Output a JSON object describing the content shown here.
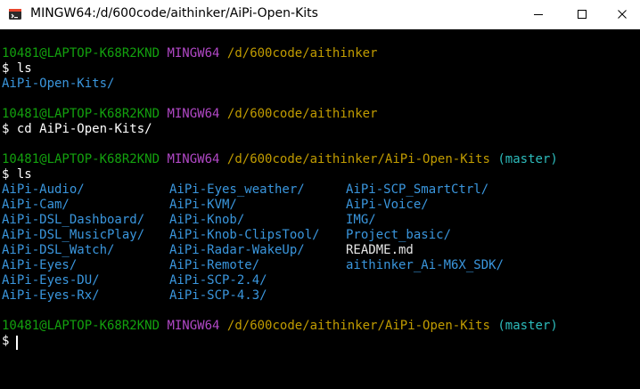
{
  "window": {
    "title": "MINGW64:/d/600code/aithinker/AiPi-Open-Kits",
    "icons": {
      "app": "git-bash-icon",
      "minimize": "minimize-icon",
      "maximize": "maximize-icon",
      "close": "close-icon"
    }
  },
  "prompt": {
    "user": "10481@LAPTOP-K68R2KND",
    "env": "MINGW64",
    "symbol": "$",
    "path1": "/d/600code/aithinker",
    "path2": "/d/600code/aithinker/AiPi-Open-Kits",
    "branch": "(master)"
  },
  "commands": {
    "ls1": "ls",
    "cd": "cd AiPi-Open-Kits/",
    "ls2": "ls"
  },
  "outputs": {
    "ls1": [
      "AiPi-Open-Kits/"
    ],
    "ls2": {
      "col1": [
        "AiPi-Audio/",
        "AiPi-Cam/",
        "AiPi-DSL_Dashboard/",
        "AiPi-DSL_MusicPlay/",
        "AiPi-DSL_Watch/",
        "AiPi-Eyes/",
        "AiPi-Eyes-DU/",
        "AiPi-Eyes-Rx/"
      ],
      "col2": [
        "AiPi-Eyes_weather/",
        "AiPi-KVM/",
        "AiPi-Knob/",
        "AiPi-Knob-ClipsTool/",
        "AiPi-Radar-WakeUp/",
        "AiPi-Remote/",
        "AiPi-SCP-2.4/",
        "AiPi-SCP-4.3/"
      ],
      "col3": [
        "AiPi-SCP_SmartCtrl/",
        "AiPi-Voice/",
        "IMG/",
        "Project_basic/",
        "README.md",
        "aithinker_Ai-M6X_SDK/"
      ]
    }
  },
  "colors": {
    "user": "#13a10e",
    "env": "#b148c6",
    "path": "#c19c00",
    "dir": "#3a96dd",
    "branch": "#2dbcbc",
    "file": "#e6e6e6"
  }
}
